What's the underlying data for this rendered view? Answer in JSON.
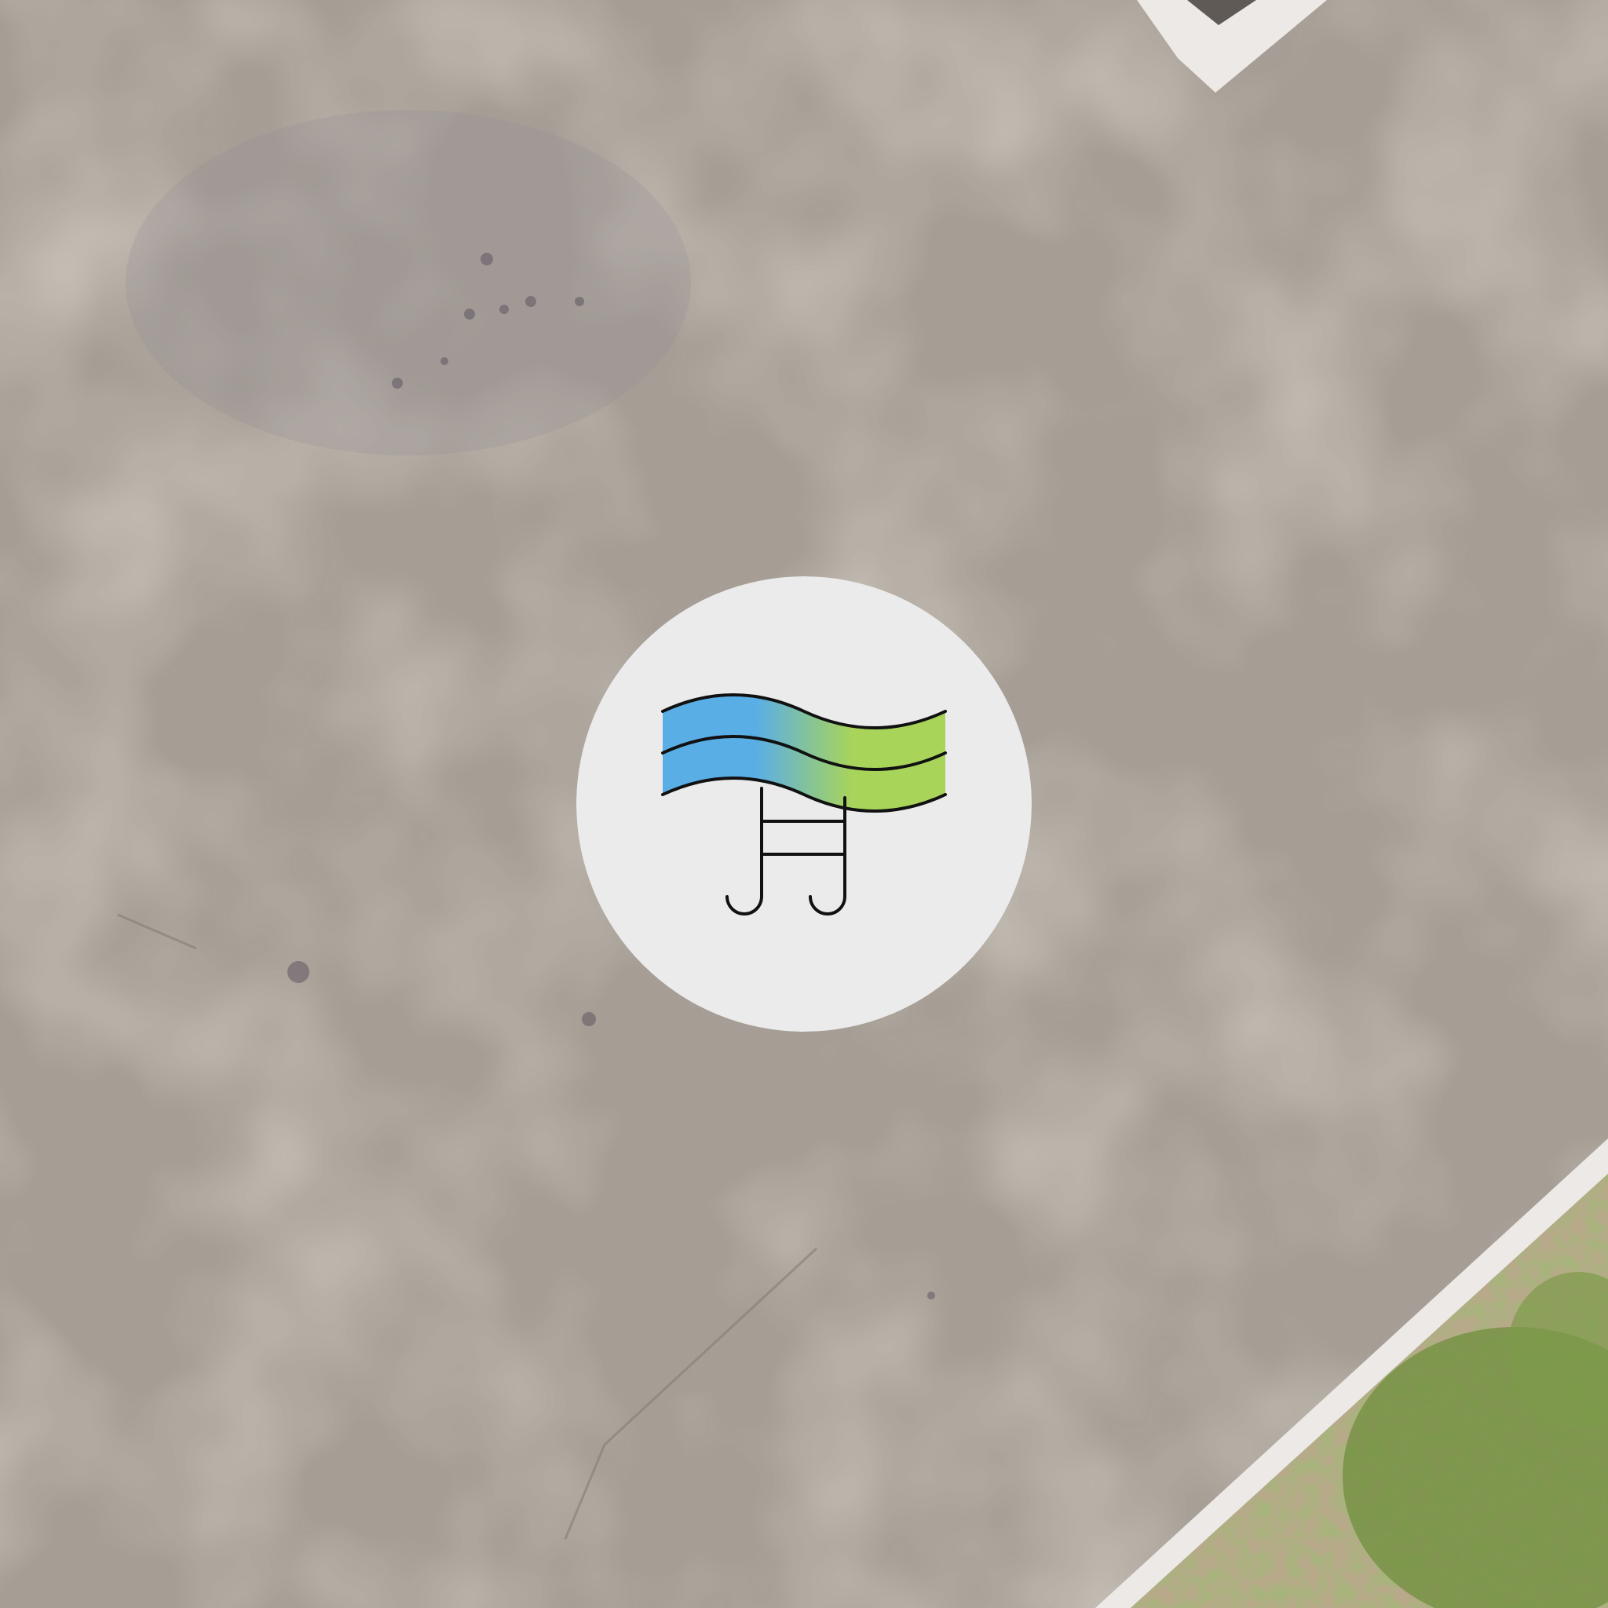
{
  "scene": {
    "description_kind": "aerial-photo",
    "colors": {
      "asphalt": "#a59d94",
      "asphalt_light": "#b8afa3",
      "asphalt_dark": "#8e8780",
      "curb": "#ece9e6",
      "drain_grate": "#5f5a56",
      "soil": "#b8a98a",
      "grass": "#7d9a4a",
      "grass_dark": "#5f7d34"
    }
  },
  "emblem": {
    "icon": "swimming-pool-icon",
    "colors": {
      "disc": "#ebebec",
      "water_left": "#5aaee6",
      "water_right": "#a8d45a",
      "outline": "#111111"
    }
  }
}
